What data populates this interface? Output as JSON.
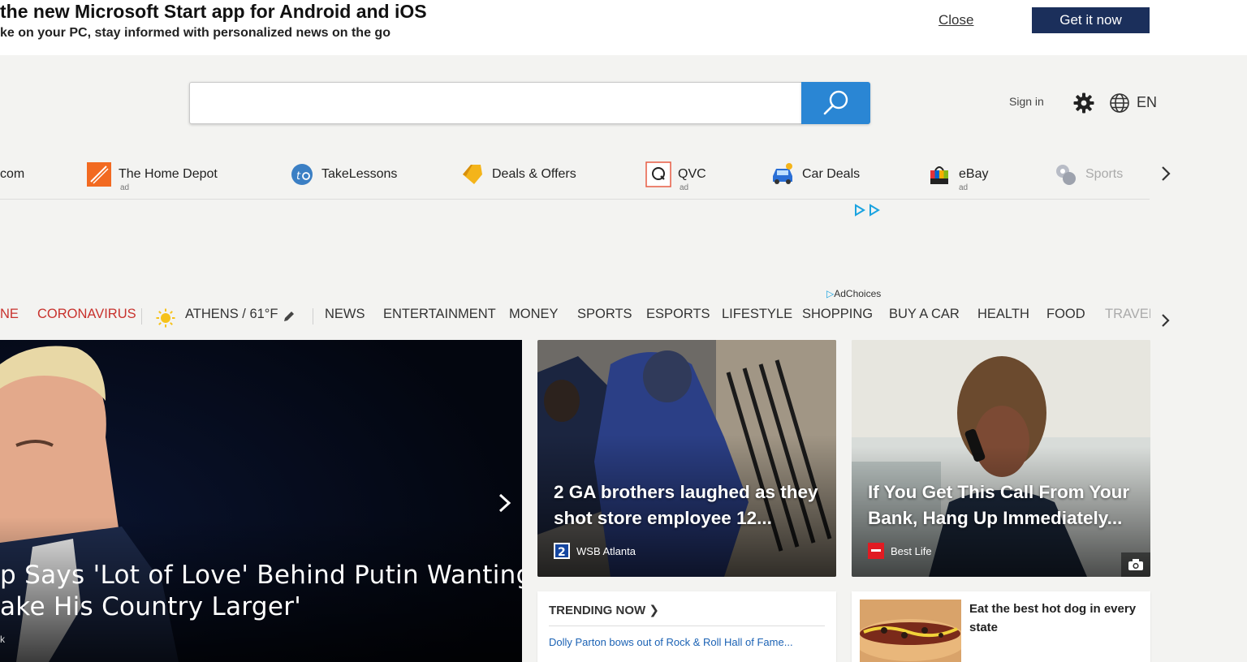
{
  "promo": {
    "title": "the new Microsoft Start app for Android and iOS",
    "subtitle": "ke on your PC, stay informed with personalized news on the go",
    "close_label": "Close",
    "cta_label": "Get it now"
  },
  "header": {
    "search_placeholder": "",
    "signin_label": "Sign in",
    "language": "EN"
  },
  "quicklinks": [
    {
      "label": "com",
      "ad": ""
    },
    {
      "label": "The Home Depot",
      "ad": "ad"
    },
    {
      "label": "TakeLessons",
      "ad": ""
    },
    {
      "label": "Deals & Offers",
      "ad": ""
    },
    {
      "label": "QVC",
      "ad": "ad"
    },
    {
      "label": "Car Deals",
      "ad": ""
    },
    {
      "label": "eBay",
      "ad": "ad"
    },
    {
      "label": "Sports",
      "ad": ""
    }
  ],
  "adchoices_label": "AdChoices",
  "nav": {
    "items": [
      "NE",
      "CORONAVIRUS",
      "ATHENS / 61°F",
      "NEWS",
      "ENTERTAINMENT",
      "MONEY",
      "SPORTS",
      "ESPORTS",
      "LIFESTYLE",
      "SHOPPING",
      "BUY A CAR",
      "HEALTH",
      "FOOD",
      "TRAVEL"
    ]
  },
  "hero": {
    "title_line1": "p Says 'Lot of Love' Behind Putin Wanting",
    "title_line2": "ake His Country Larger'",
    "source": "k"
  },
  "cards": [
    {
      "title": "2 GA brothers laughed as they shot store employee 12...",
      "source": "WSB Atlanta"
    },
    {
      "title": "If You Get This Call From Your Bank, Hang Up Immediately...",
      "source": "Best Life"
    }
  ],
  "trending": {
    "heading": "TRENDING NOW",
    "item": "Dolly Parton bows out of Rock & Roll Hall of Fame..."
  },
  "hotdog": {
    "title": "Eat the best hot dog in every state"
  },
  "colors": {
    "accent": "#2a86d4",
    "cta_bg": "#1b2f5b",
    "nav_red": "#c8322d",
    "link_blue": "#1b62b4"
  }
}
